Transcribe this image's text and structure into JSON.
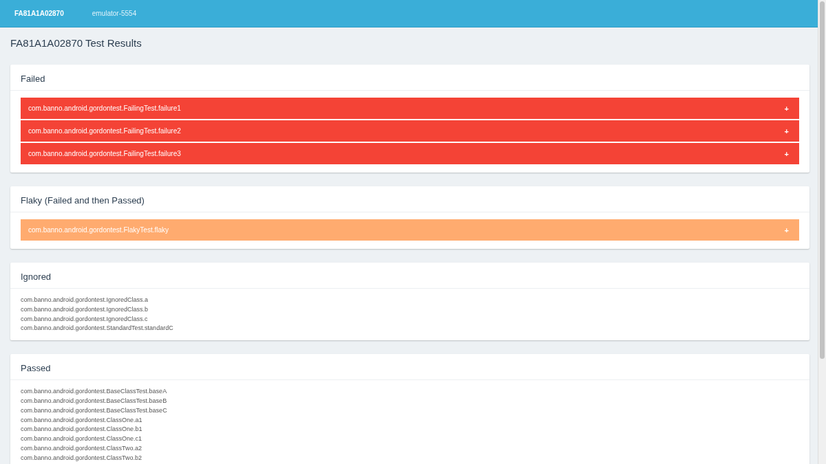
{
  "tabs": [
    {
      "label": "FA81A1A02870",
      "selected": true
    },
    {
      "label": "emulator-5554",
      "selected": false
    }
  ],
  "page_title": "FA81A1A02870 Test Results",
  "sections": [
    {
      "kind": "rows",
      "title": "Failed",
      "color": "#f44336",
      "tests": [
        {
          "name": "com.banno.android.gordontest.FailingTest.failure1",
          "toggle": "+"
        },
        {
          "name": "com.banno.android.gordontest.FailingTest.failure2",
          "toggle": "+"
        },
        {
          "name": "com.banno.android.gordontest.FailingTest.failure3",
          "toggle": "+"
        }
      ]
    },
    {
      "kind": "rows",
      "title": "Flaky (Failed and then Passed)",
      "color": "#ffab6f",
      "tests": [
        {
          "name": "com.banno.android.gordontest.FlakyTest.flaky",
          "toggle": "+"
        }
      ]
    },
    {
      "kind": "list",
      "title": "Ignored",
      "tests": [
        {
          "name": "com.banno.android.gordontest.IgnoredClass.a"
        },
        {
          "name": "com.banno.android.gordontest.IgnoredClass.b"
        },
        {
          "name": "com.banno.android.gordontest.IgnoredClass.c"
        },
        {
          "name": "com.banno.android.gordontest.StandardTest.standardC"
        }
      ]
    },
    {
      "kind": "list",
      "title": "Passed",
      "tests": [
        {
          "name": "com.banno.android.gordontest.BaseClassTest.baseA"
        },
        {
          "name": "com.banno.android.gordontest.BaseClassTest.baseB"
        },
        {
          "name": "com.banno.android.gordontest.BaseClassTest.baseC"
        },
        {
          "name": "com.banno.android.gordontest.ClassOne.a1"
        },
        {
          "name": "com.banno.android.gordontest.ClassOne.b1"
        },
        {
          "name": "com.banno.android.gordontest.ClassOne.c1"
        },
        {
          "name": "com.banno.android.gordontest.ClassTwo.a2"
        },
        {
          "name": "com.banno.android.gordontest.ClassTwo.b2"
        }
      ]
    }
  ]
}
